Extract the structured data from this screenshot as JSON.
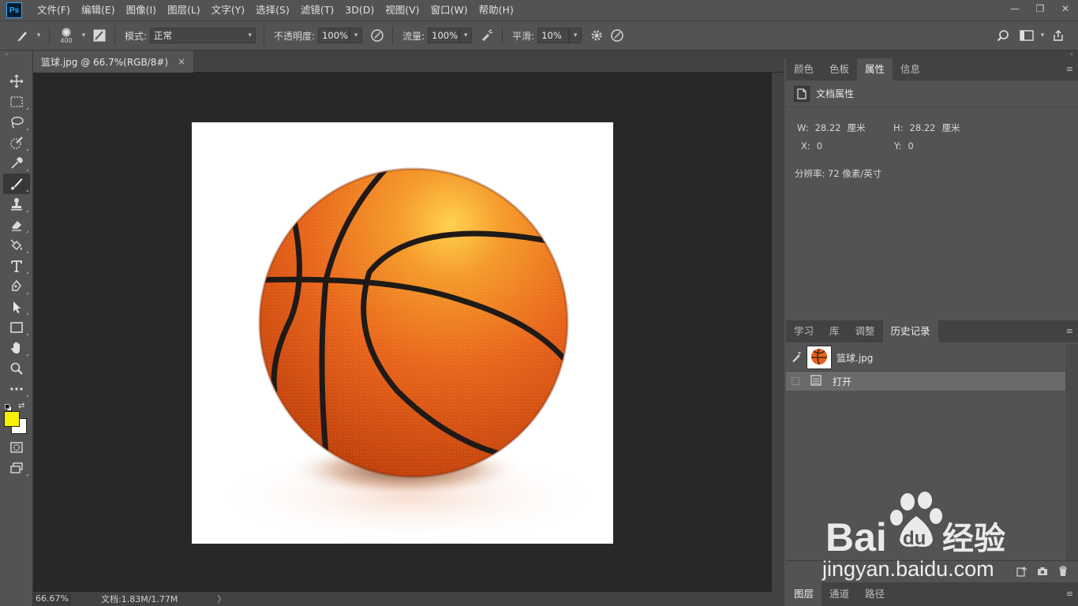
{
  "app": {
    "logo_text": "Ps"
  },
  "menu": [
    "文件(F)",
    "编辑(E)",
    "图像(I)",
    "图层(L)",
    "文字(Y)",
    "选择(S)",
    "滤镜(T)",
    "3D(D)",
    "视图(V)",
    "窗口(W)",
    "帮助(H)"
  ],
  "window_controls": {
    "minimize": "—",
    "restore": "❐",
    "close": "✕"
  },
  "options": {
    "brush_size": "400",
    "mode_label": "模式:",
    "mode_value": "正常",
    "opacity_label": "不透明度:",
    "opacity_value": "100%",
    "flow_label": "流量:",
    "flow_value": "100%",
    "smoothing_label": "平滑:",
    "smoothing_value": "10%"
  },
  "document": {
    "tab_title": "篮球.jpg @ 66.7%(RGB/8#)",
    "tab_close": "×",
    "zoom": "66.67%",
    "doc_size": "文档:1.83M/1.77M",
    "status_arrow": "〉"
  },
  "properties_panel": {
    "tabs": [
      "颜色",
      "色板",
      "属性",
      "信息"
    ],
    "active_tab": 2,
    "header": "文档属性",
    "w_label": "W:",
    "w_value": "28.22",
    "w_unit": "厘米",
    "h_label": "H:",
    "h_value": "28.22",
    "h_unit": "厘米",
    "x_label": "X:",
    "x_value": "0",
    "y_label": "Y:",
    "y_value": "0",
    "resolution": "分辨率: 72 像素/英寸"
  },
  "history_panel": {
    "tabs": [
      "学习",
      "库",
      "调整",
      "历史记录"
    ],
    "active_tab": 3,
    "snapshot_name": "篮球.jpg",
    "steps": [
      "打开"
    ]
  },
  "layers_panel": {
    "tabs": [
      "图层",
      "通道",
      "路径"
    ],
    "active_tab": 0
  },
  "colors": {
    "foreground": "#f8f000",
    "background": "#ffffff",
    "accent": "#31a8ff"
  },
  "watermark": {
    "brand": "Bai du 经验",
    "url": "jingyan.baidu.com"
  }
}
